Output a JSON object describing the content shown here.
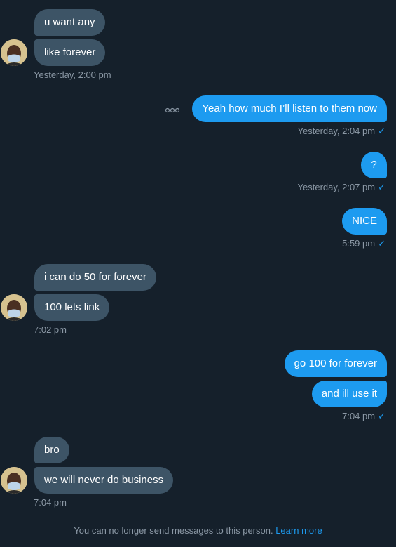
{
  "messages": {
    "m1": "u want any",
    "m2": "like forever",
    "t1": "Yesterday, 2:00 pm",
    "m3": "Yeah how much I’ll listen to them now",
    "t2": "Yesterday, 2:04 pm",
    "m4": "?",
    "t3": "Yesterday, 2:07 pm",
    "m5": "NICE",
    "t4": "5:59 pm",
    "m6": "i can do 50 for forever",
    "m7": "100 lets link",
    "t5": "7:02 pm",
    "m8": "go 100 for forever",
    "m9": "and ill use it",
    "t6": "7:04 pm",
    "m10": "bro",
    "m11": "we will never do business",
    "t7": "7:04 pm"
  },
  "read_mark": "✓",
  "footer": {
    "notice": "You can no longer send messages to this person.",
    "link": "Learn more"
  },
  "colors": {
    "background": "#15202b",
    "incoming_bubble": "#3d5466",
    "outgoing_bubble": "#1d9bf0",
    "muted_text": "#8b98a5"
  },
  "icons": [
    "avatar",
    "more-options-icon",
    "checkmark-icon"
  ]
}
